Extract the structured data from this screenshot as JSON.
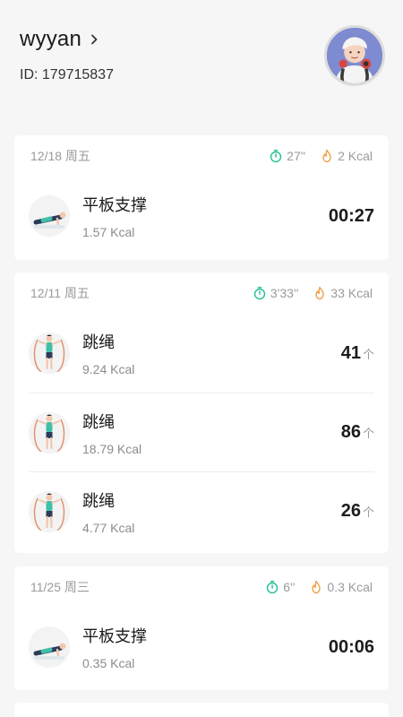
{
  "profile": {
    "username": "wyyan",
    "id_text": "ID: 179715837"
  },
  "records": [
    {
      "date": "12/18 周五",
      "duration": "27''",
      "calories": "2 Kcal",
      "items": [
        {
          "name": "平板支撑",
          "kcal": "1.57 Kcal",
          "value": "00:27",
          "unit": "",
          "icon": "plank-icon"
        }
      ]
    },
    {
      "date": "12/11 周五",
      "duration": "3'33''",
      "calories": "33 Kcal",
      "items": [
        {
          "name": "跳绳",
          "kcal": "9.24 Kcal",
          "value": "41",
          "unit": "个",
          "icon": "jump-rope-icon"
        },
        {
          "name": "跳绳",
          "kcal": "18.79 Kcal",
          "value": "86",
          "unit": "个",
          "icon": "jump-rope-icon"
        },
        {
          "name": "跳绳",
          "kcal": "4.77 Kcal",
          "value": "26",
          "unit": "个",
          "icon": "jump-rope-icon"
        }
      ]
    },
    {
      "date": "11/25 周三",
      "duration": "6''",
      "calories": "0.3 Kcal",
      "items": [
        {
          "name": "平板支撑",
          "kcal": "0.35 Kcal",
          "value": "00:06",
          "unit": "",
          "icon": "plank-icon"
        }
      ]
    }
  ],
  "colors": {
    "timer": "#2bc29b",
    "fire": "#f0a04b",
    "background": "#f6f6f6"
  }
}
